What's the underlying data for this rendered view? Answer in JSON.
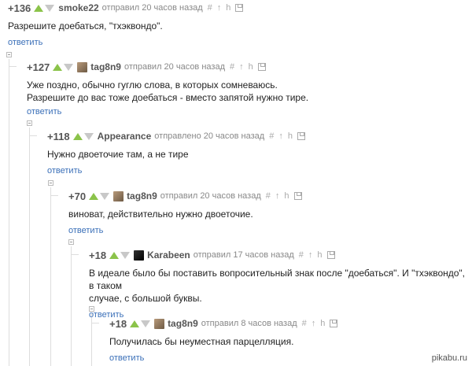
{
  "comments": [
    {
      "rating": "+136",
      "author": "smoke22",
      "meta": "отправил 20 часов назад",
      "text": "Разрешите доебаться, \"тхэквондо\".",
      "reply": "ответить"
    },
    {
      "rating": "+127",
      "author": "tag8n9",
      "meta": "отправил 20 часов назад",
      "text1": "Уже поздно, обычно гуглю слова, в которых сомневаюсь.",
      "text2": "Разрешите до вас тоже доебаться - вместо запятой нужно тире.",
      "reply": "ответить"
    },
    {
      "rating": "+118",
      "author": "Appearance",
      "meta": "отправлено 20 часов назад",
      "text": "Нужно двоеточие там, а не тире",
      "reply": "ответить"
    },
    {
      "rating": "+70",
      "author": "tag8n9",
      "meta": "отправил 20 часов назад",
      "text": "виноват, действительно нужно двоеточие.",
      "reply": "ответить"
    },
    {
      "rating": "+18",
      "author": "Karabeen",
      "meta": "отправил 17 часов назад",
      "text1": "В идеале было бы поставить вопросительный знак после \"доебаться\". И \"тхэквондо\", в таком",
      "text2": "случае, с большой буквы.",
      "reply": "ответить"
    },
    {
      "rating": "+18",
      "author": "tag8n9",
      "meta": "отправил 8 часов назад",
      "text": "Получилась бы неуместная парцелляция.",
      "reply": "ответить"
    }
  ],
  "icons": {
    "link": "#",
    "up": "↑",
    "branch": "h"
  },
  "watermark": "pikabu.ru",
  "colors": {
    "vote_up": "#8bc34a",
    "vote_down": "#c8c8c8",
    "reply_link": "#3a6fb8"
  }
}
